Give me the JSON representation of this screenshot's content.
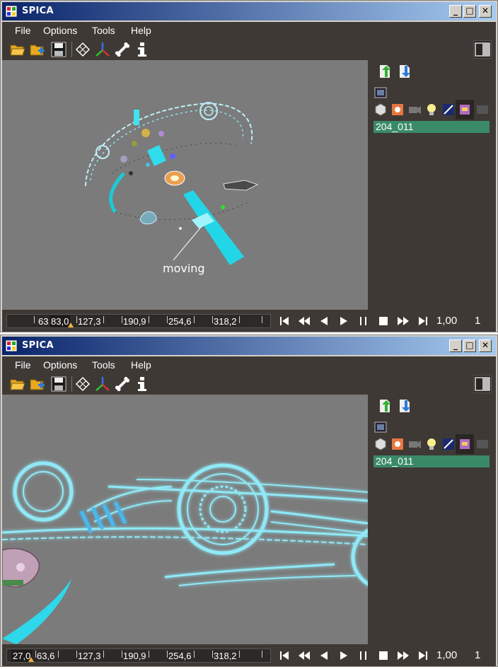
{
  "app": {
    "title": "SPICA"
  },
  "menu": {
    "file": "File",
    "options": "Options",
    "tools": "Tools",
    "help": "Help"
  },
  "toolbar": {
    "icons": [
      "open-folder-icon",
      "add-folder-icon",
      "save-icon",
      "mesh-icon",
      "axes-icon",
      "bone-icon",
      "info-icon"
    ],
    "layout_icon": "layout-toggle-icon"
  },
  "sidepanel": {
    "icons": [
      "import-icon",
      "export-icon",
      "film-icon",
      "model-icon",
      "texture-icon",
      "camera-icon",
      "light-icon",
      "animation-icon",
      "material-icon",
      "disabled-icon"
    ],
    "selected_item": "204_011"
  },
  "windows": [
    {
      "annotation": "moving",
      "timeline": {
        "cursor_value": "83,0",
        "labels": [
          "63,",
          "127,3",
          "190,9",
          "254,6",
          "318,2"
        ]
      },
      "speed": "1,00",
      "frame": "1"
    },
    {
      "annotation": "",
      "timeline": {
        "cursor_value": "27,0",
        "labels": [
          "63,6",
          "127,3",
          "190,9",
          "254,6",
          "318,2"
        ]
      },
      "speed": "1,00",
      "frame": "1"
    }
  ],
  "colors": {
    "accent_cyan": "#2ee6f2",
    "selection_green": "#3a8a67",
    "panel_dark": "#3e3935",
    "viewport_gray": "#7b7b7b"
  }
}
